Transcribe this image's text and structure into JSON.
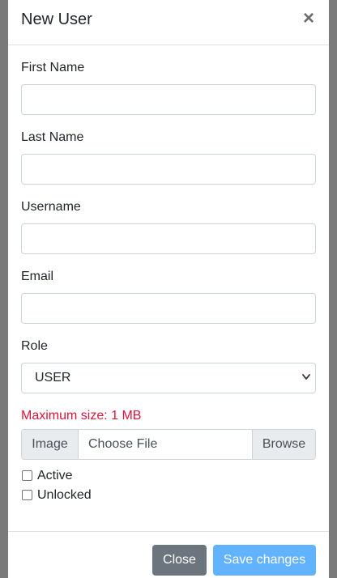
{
  "modal": {
    "title": "New User",
    "close_glyph": "×"
  },
  "form": {
    "first_name": {
      "label": "First Name",
      "value": "",
      "placeholder": ""
    },
    "last_name": {
      "label": "Last Name",
      "value": "",
      "placeholder": ""
    },
    "username": {
      "label": "Username",
      "value": "",
      "placeholder": ""
    },
    "email": {
      "label": "Email",
      "value": "",
      "placeholder": ""
    },
    "role": {
      "label": "Role",
      "selected": "USER"
    },
    "image": {
      "max_size_note": "Maximum size: 1 MB",
      "prepend_label": "Image",
      "choose_text": "Choose File",
      "browse_label": "Browse"
    },
    "active": {
      "label": "Active",
      "checked": false
    },
    "unlocked": {
      "label": "Unlocked",
      "checked": false
    }
  },
  "footer": {
    "close_label": "Close",
    "save_label": "Save changes"
  },
  "colors": {
    "secondary": "#6c757d",
    "primary_disabled": "#61b2ff",
    "danger_text": "#dc143c",
    "backdrop": "#7a7a7a"
  },
  "icons": {
    "close": "close-icon",
    "select": "chevron-down-icon"
  }
}
